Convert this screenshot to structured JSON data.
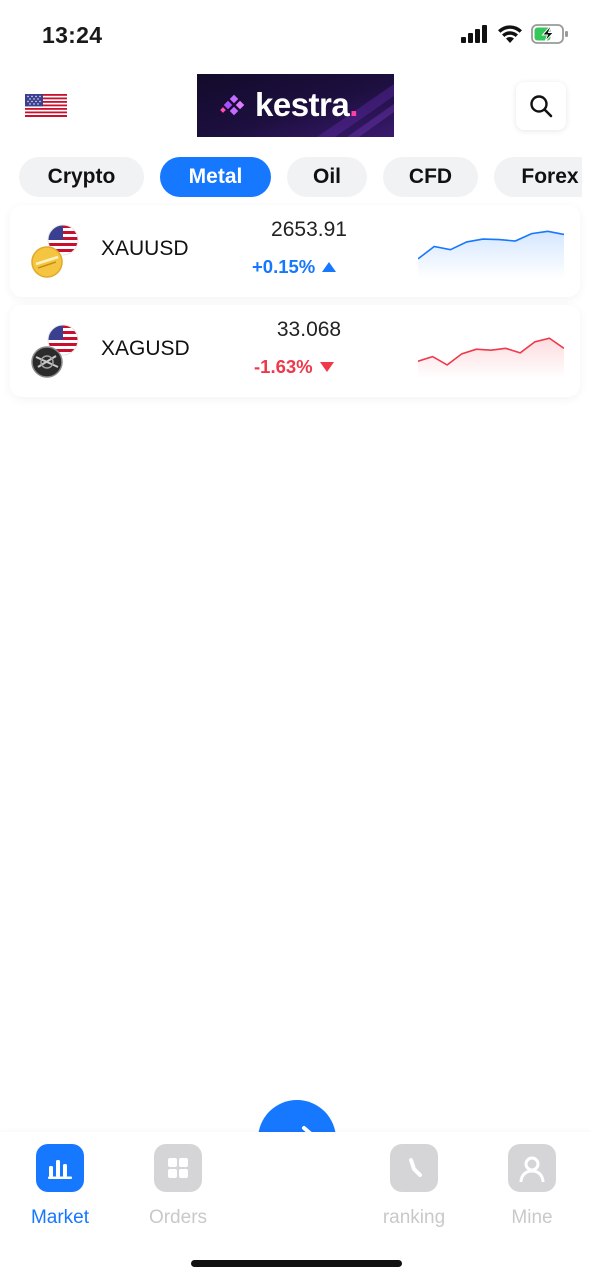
{
  "status_bar": {
    "time": "13:24",
    "battery": "charging"
  },
  "header": {
    "logo_text": "kestra",
    "logo_dot": "."
  },
  "tabs": [
    {
      "label": "Crypto",
      "active": false
    },
    {
      "label": "Metal",
      "active": true
    },
    {
      "label": "Oil",
      "active": false
    },
    {
      "label": "CFD",
      "active": false
    },
    {
      "label": "Forex",
      "active": false
    }
  ],
  "markets": [
    {
      "symbol": "XAUUSD",
      "price": "2653.91",
      "change": "+0.15%",
      "direction": "up",
      "color": "#1677ff",
      "sparkline": [
        0.35,
        0.62,
        0.55,
        0.72,
        0.78,
        0.77,
        0.74,
        0.9,
        0.95,
        0.88
      ]
    },
    {
      "symbol": "XAGUSD",
      "price": "33.068",
      "change": "-1.63%",
      "direction": "down",
      "color": "#f0384a",
      "sparkline": [
        0.3,
        0.4,
        0.22,
        0.46,
        0.56,
        0.54,
        0.58,
        0.48,
        0.72,
        0.8,
        0.58
      ]
    }
  ],
  "bottom_nav": {
    "items": [
      {
        "label": "Market",
        "icon": "bar-chart-icon",
        "active": true
      },
      {
        "label": "Orders",
        "icon": "grid-icon",
        "active": false
      },
      {
        "label": "ranking",
        "icon": "clock-icon",
        "active": false
      },
      {
        "label": "Mine",
        "icon": "user-icon",
        "active": false
      }
    ],
    "center_icon": "swap-icon"
  },
  "colors": {
    "accent": "#1677ff",
    "up": "#1677ff",
    "down": "#f0384a"
  }
}
